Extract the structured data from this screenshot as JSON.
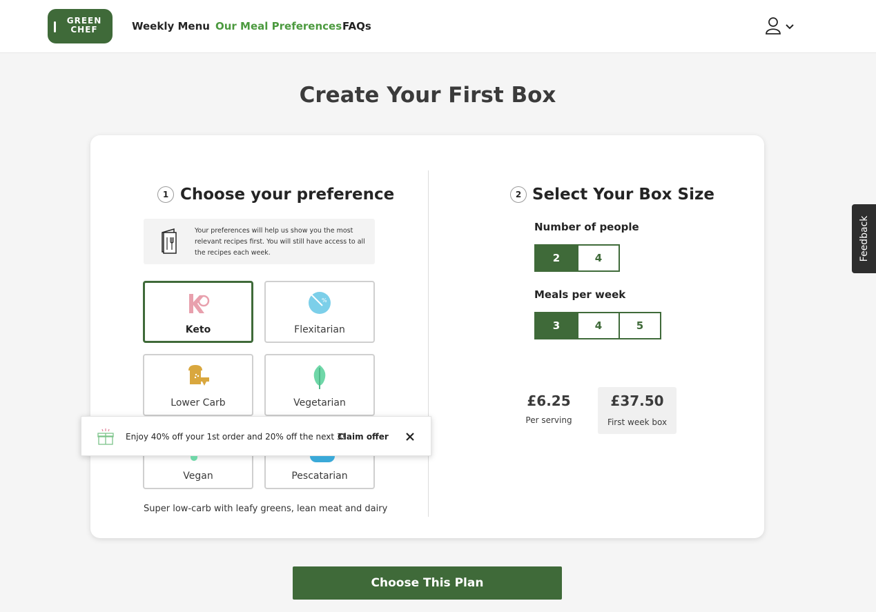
{
  "header": {
    "logo_line1": "GREEN",
    "logo_line2": "CHEF",
    "nav": [
      "Weekly Menu",
      "Our Meal Preferences",
      "FAQs"
    ]
  },
  "page_title": "Create Your First Box",
  "preference": {
    "step_number": "1",
    "title": "Choose your preference",
    "info_text": "Your preferences will help us show you the most relevant recipes first. You will still have access to all the recipes each week.",
    "options": [
      "Keto",
      "Flexitarian",
      "Lower Carb",
      "Vegetarian",
      "Vegan",
      "Pescatarian"
    ],
    "selected": "Keto",
    "description": "Super low-carb with leafy greens, lean meat and dairy"
  },
  "box_size": {
    "step_number": "2",
    "title": "Select Your Box Size",
    "people_label": "Number of people",
    "people_options": [
      "2",
      "4"
    ],
    "people_selected": "2",
    "meals_label": "Meals per week",
    "meals_options": [
      "3",
      "4",
      "5"
    ],
    "meals_selected": "3"
  },
  "pricing": {
    "per_serving": "£6.25",
    "per_serving_label": "Per serving",
    "total": "£37.50",
    "total_label": "First week box"
  },
  "toast": {
    "text": "Enjoy 40% off your 1st order and 20% off the next 3!",
    "link": "Claim offer"
  },
  "cta_label": "Choose This Plan",
  "feedback_label": "Feedback",
  "colors": {
    "brand_green": "#3f6a39",
    "active_nav": "#4c9a3f",
    "keto_icon": "#e8a0ad",
    "flexitarian_icon": "#7ccfe9",
    "lower_carb_icon": "#d9a73e",
    "vegetarian_icon": "#6fd7a8"
  }
}
